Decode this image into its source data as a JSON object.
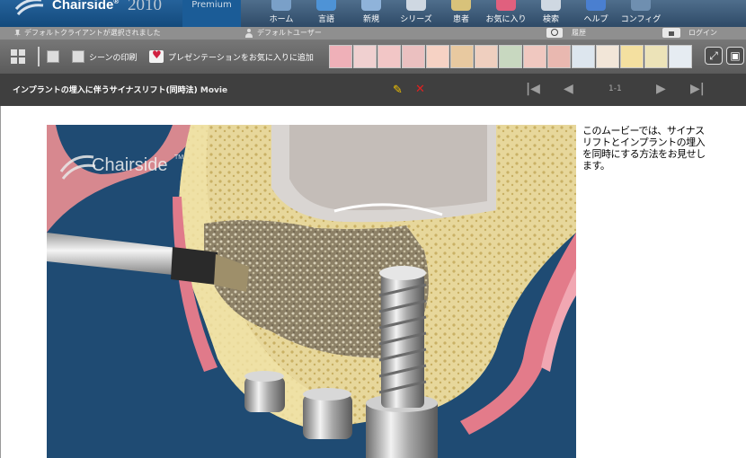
{
  "app": {
    "name": "Chairside",
    "year": "2010",
    "edition": "Premium"
  },
  "nav": [
    {
      "label": "ホーム",
      "icon": "home-icon",
      "color": "#7aa0c8"
    },
    {
      "label": "言語",
      "icon": "language-icon",
      "color": "#4e93d6"
    },
    {
      "label": "新規",
      "icon": "new-icon",
      "color": "#8fb3da"
    },
    {
      "label": "シリーズ",
      "icon": "series-icon",
      "color": "#cfd8e2"
    },
    {
      "label": "患者",
      "icon": "patient-icon",
      "color": "#d8c27a"
    },
    {
      "label": "お気に入り",
      "icon": "favorites-icon",
      "color": "#e0607e"
    },
    {
      "label": "検索",
      "icon": "search-icon",
      "color": "#cfd8e2"
    },
    {
      "label": "ヘルプ",
      "icon": "help-icon",
      "color": "#4a7fd0"
    },
    {
      "label": "コンフィグ",
      "icon": "config-icon",
      "color": "#6f8fb0"
    }
  ],
  "status": {
    "client_text": "デフォルトクライアントが選択されました",
    "user_text": "デフォルトユーザー",
    "history_label": "履歴",
    "login_label": "ログイン"
  },
  "toolbar": {
    "print_label": "シーンの印刷",
    "favorite_label": "プレゼンテーションをお気に入りに追加",
    "thumbnail_colors": [
      "#efb0b8",
      "#f0d0d0",
      "#f2c6c6",
      "#ebc0c0",
      "#f6d2c4",
      "#e8c9a0",
      "#efcfbf",
      "#c8d8c0",
      "#f0c8c0",
      "#e9b8b0",
      "#dde6ee",
      "#f2e6d8",
      "#f4e0a0",
      "#ece3b8",
      "#e6ecf2"
    ]
  },
  "title": {
    "text": "インプラントの埋入に伴うサイナスリフト(同時法)",
    "media_type": "Movie",
    "page_indicator": "1-1"
  },
  "video": {
    "watermark": "Chairside",
    "watermark_tm": "TM"
  },
  "description": "このムービーでは、サイナスリフトとインプラントの埋入を同時にする方法をお見せします。"
}
